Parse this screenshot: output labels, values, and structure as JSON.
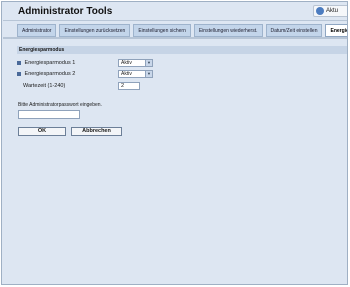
{
  "header": {
    "title": "Administrator Tools",
    "update_label": "Aktu"
  },
  "tabs": [
    {
      "label": "Administrator",
      "active": false
    },
    {
      "label": "Einstellungen zurücksetzen",
      "active": false
    },
    {
      "label": "Einstellungen sichern",
      "active": false
    },
    {
      "label": "Einstellungen wiederherst.",
      "active": false
    },
    {
      "label": "Datum/Zeit einstellen",
      "active": false
    },
    {
      "label": "Energiesparmodus",
      "active": true
    }
  ],
  "section": {
    "title": "Energiesparmodus"
  },
  "settings": {
    "mode1": {
      "label": "Energiesparmodus 1",
      "value": "Aktiv"
    },
    "mode2": {
      "label": "Energiesparmodus 2",
      "value": "Aktiv"
    },
    "wait": {
      "label": "Wartezeit (1-240)",
      "value": "2"
    }
  },
  "password": {
    "label": "Bitte Administratorpasswort eingeben.",
    "value": ""
  },
  "actions": {
    "ok_label": "OK",
    "cancel_label": "Abbrechen"
  },
  "colors": {
    "background": "#dde6f2",
    "tab": "#c3d5ea",
    "section": "#c6d4e6",
    "accent": "#4a6a9a"
  },
  "icons": {
    "update": "refresh-icon",
    "select_arrow": "chevron-down-icon",
    "bullet": "square-bullet-icon"
  }
}
